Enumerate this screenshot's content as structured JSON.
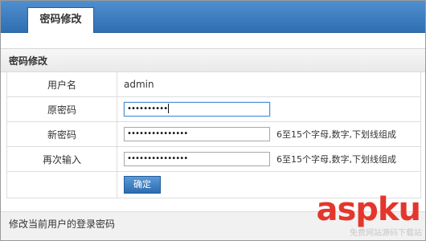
{
  "tab": {
    "label": "密码修改"
  },
  "section": {
    "title": "密码修改"
  },
  "form": {
    "username": {
      "label": "用户名",
      "value": "admin"
    },
    "old_password": {
      "label": "原密码",
      "masked_value": "••••••••••"
    },
    "new_password": {
      "label": "新密码",
      "masked_value": "•••••••••••••••",
      "hint": "6至15个字母,数字,下划线组成"
    },
    "confirm_password": {
      "label": "再次输入",
      "masked_value": "•••••••••••••••",
      "hint": "6至15个字母,数字,下划线组成"
    },
    "submit_label": "确定"
  },
  "footer": {
    "text": "修改当前用户的登录密码"
  },
  "watermark": {
    "main": "aspku",
    "sub": "免费网站源码下载站"
  },
  "colors": {
    "accent": "#2f6fb1",
    "watermark": "#e4362c"
  }
}
